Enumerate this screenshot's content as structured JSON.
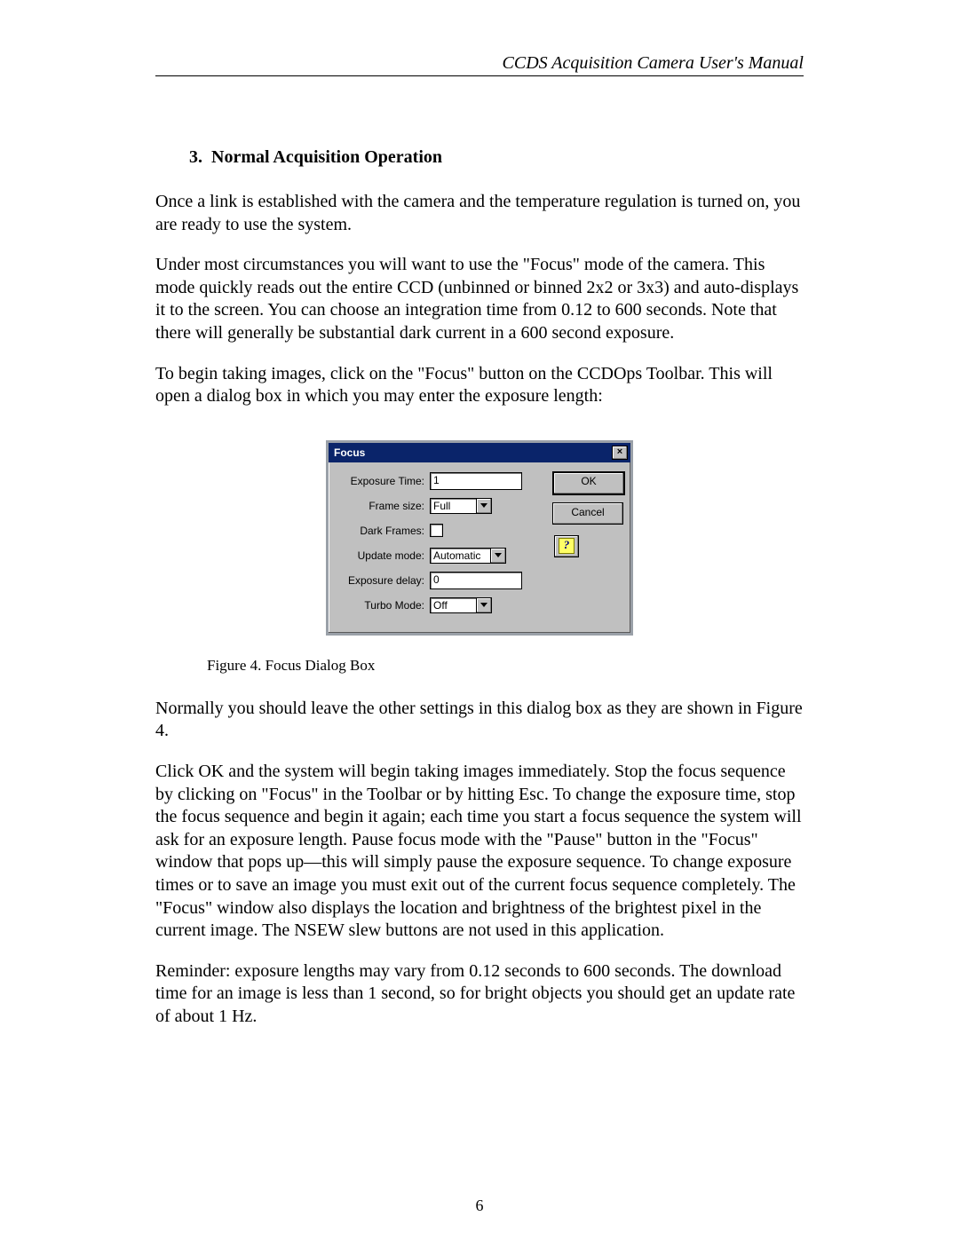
{
  "header": "CCDS Acquisition Camera User's Manual",
  "section": {
    "number": "3.",
    "title": "Normal Acquisition Operation"
  },
  "paragraphs": {
    "p1": "Once a link is established with the camera and the temperature regulation is turned on, you are ready to use the system.",
    "p2": "Under most circumstances you will want to use the \"Focus\" mode of the camera.  This mode quickly reads out the entire CCD (unbinned or binned 2x2 or 3x3) and auto-displays it to the screen.  You can choose an integration time from 0.12 to 600 seconds.  Note that there will generally be substantial dark current in a 600 second exposure.",
    "p3": "To begin taking images, click on the \"Focus\" button on the CCDOps Toolbar.  This will open a dialog box in which you may enter the exposure length:",
    "p4": "Normally you should leave the other settings in this dialog box as they are shown in Figure 4.",
    "p5": "Click OK and the system will begin taking images immediately.  Stop the focus sequence by clicking on \"Focus\" in the Toolbar or by hitting Esc.  To change the exposure time, stop the focus sequence and begin it again; each time you start a focus sequence the system will ask for an exposure length.  Pause focus mode with the \"Pause\" button in the \"Focus\" window that pops up—this will simply pause the exposure sequence.  To change exposure times or to save an image you must exit out of the current focus sequence completely.  The \"Focus\" window also displays the location and brightness of the brightest pixel in the current image.  The NSEW slew buttons are not used in this application.",
    "p6": "Reminder: exposure lengths may vary from 0.12 seconds to 600 seconds.  The download time for an image is less than 1 second, so for bright objects you should get an update rate of about 1 Hz."
  },
  "figure_caption": "Figure 4. Focus Dialog Box",
  "page_number": "6",
  "dialog": {
    "title": "Focus",
    "close_glyph": "×",
    "fields": {
      "exposure_time": {
        "label": "Exposure Time:",
        "value": "1"
      },
      "frame_size": {
        "label": "Frame size:",
        "value": "Full"
      },
      "dark_frames": {
        "label": "Dark Frames:"
      },
      "update_mode": {
        "label": "Update mode:",
        "value": "Automatic"
      },
      "exposure_delay": {
        "label": "Exposure delay:",
        "value": "0"
      },
      "turbo_mode": {
        "label": "Turbo Mode:",
        "value": "Off"
      }
    },
    "buttons": {
      "ok": "OK",
      "cancel": "Cancel",
      "help": "?"
    }
  }
}
